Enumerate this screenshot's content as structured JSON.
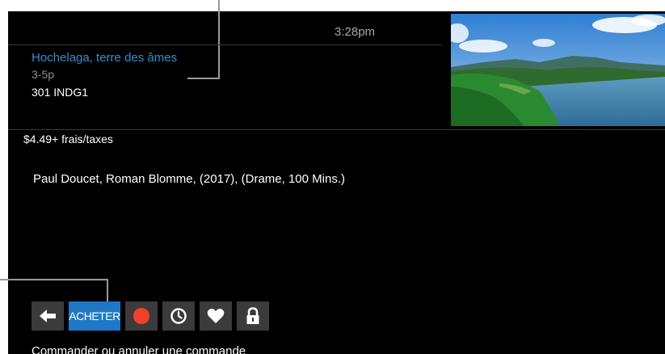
{
  "header": {
    "time": "3:28pm"
  },
  "program": {
    "title": "Hochelaga, terre des âmes",
    "time": "3-5p",
    "channel": "301 INDG1",
    "price": "$4.49+ frais/taxes",
    "credits": "Paul Doucet, Roman Blomme, (2017), (Drame, 100 Mins.)"
  },
  "thumbnail": {
    "subject": "aerial view of lake and green hills"
  },
  "actions": {
    "buy_label": "ACHETER",
    "icons": [
      "back-arrow-icon",
      "record-icon",
      "clock-icon",
      "heart-icon",
      "lock-icon"
    ]
  },
  "hint": "Commander ou annuler une commande",
  "colors": {
    "background": "#000000",
    "accent": "#1f78c6",
    "title": "#2e8fd0",
    "button": "#3b3b3b",
    "record": "#f2402b"
  }
}
